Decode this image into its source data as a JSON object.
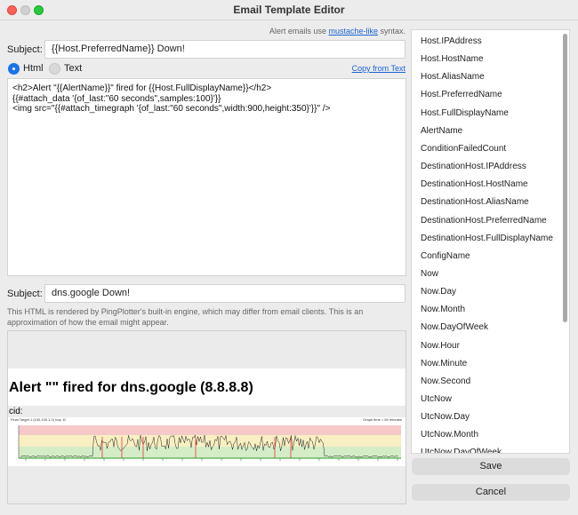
{
  "window": {
    "title": "Email Template Editor"
  },
  "hint": {
    "prefix": "Alert emails use ",
    "link": "mustache-like",
    "suffix": " syntax."
  },
  "subject1": {
    "label": "Subject:",
    "value": "{{Host.PreferredName}} Down!"
  },
  "format": {
    "html_label": "Html",
    "text_label": "Text",
    "selected": "Html",
    "copy_link": "Copy from Text"
  },
  "template_lines": [
    "<h2>Alert \"{{AlertName}}\" fired for {{Host.FullDisplayName}}</h2>",
    "{{#attach_data '{of_last:\"60 seconds\",samples:100}'}}",
    "<img src=\"{{#attach_timegraph '{of_last:\"60 seconds\",width:900,height:350}'}}\" />"
  ],
  "subject2": {
    "label": "Subject:",
    "value": "dns.google Down!"
  },
  "note": "This HTML is rendered by PingPlotter's built-in engine, which may differ from email clients. This is an approximation of how the email might appear.",
  "preview": {
    "heading": "Alert \"\" fired for dns.google (8.8.8.8)",
    "cid": "cid:",
    "graph_left": "Final Target.1 (100.100.1.2) hop 11",
    "graph_right": "Graph time = 60 minutes",
    "colors": {
      "red_zone": "#f6c9c9",
      "yellow_zone": "#f8efc2",
      "green_zone": "#d4edc7",
      "axis": "#2c9a2c",
      "marker": "#e03a3a"
    }
  },
  "variables": [
    "Host.IPAddress",
    "Host.HostName",
    "Host.AliasName",
    "Host.PreferredName",
    "Host.FullDisplayName",
    "AlertName",
    "ConditionFailedCount",
    "DestinationHost.IPAddress",
    "DestinationHost.HostName",
    "DestinationHost.AliasName",
    "DestinationHost.PreferredName",
    "DestinationHost.FullDisplayName",
    "ConfigName",
    "Now",
    "Now.Day",
    "Now.Month",
    "Now.DayOfWeek",
    "Now.Hour",
    "Now.Minute",
    "Now.Second",
    "UtcNow",
    "UtcNow.Day",
    "UtcNow.Month",
    "UtcNow.DayOfWeek"
  ],
  "buttons": {
    "save": "Save",
    "cancel": "Cancel"
  }
}
